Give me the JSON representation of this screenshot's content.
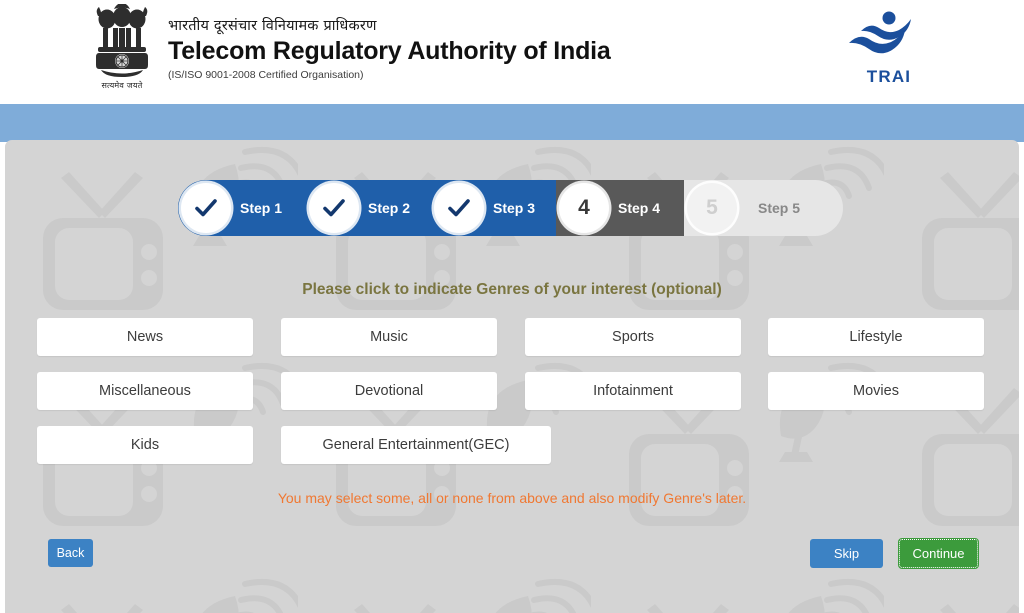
{
  "header": {
    "emblem_name": "ashoka-lion-capital-emblem",
    "emblem_motto": "सत्यमेव जयते",
    "title_hindi": "भारतीय दूरसंचार विनियामक प्राधिकरण",
    "title_main": "Telecom Regulatory Authority of India",
    "title_sub": "(IS/ISO 9001-2008 Certified Organisation)",
    "logo_text": "TRAI",
    "logo_name": "trai-logo",
    "colors": {
      "band": "#7facd9",
      "logo_blue": "#1b4f9c",
      "panel_gray": "#d4d4d4"
    }
  },
  "stepper": {
    "steps": [
      {
        "label": "Step 1",
        "marker": "check",
        "state": "completed"
      },
      {
        "label": "Step 2",
        "marker": "check",
        "state": "completed"
      },
      {
        "label": "Step 3",
        "marker": "check",
        "state": "completed"
      },
      {
        "label": "Step 4",
        "marker": "4",
        "state": "current"
      },
      {
        "label": "Step 5",
        "marker": "5",
        "state": "upcoming"
      }
    ],
    "colors": {
      "completed": "#1f5faa",
      "current": "#595959",
      "upcoming": "#e6e6e6"
    }
  },
  "main": {
    "instruction": "Please click to indicate Genres of your interest",
    "instruction_optional": "(optional)",
    "instruction_color": "#7a7540",
    "note": "You may select some, all or none from above and also modify Genre's later.",
    "note_color": "#f07832",
    "genres": [
      [
        "News",
        "Music",
        "Sports",
        "Lifestyle"
      ],
      [
        "Miscellaneous",
        "Devotional",
        "Infotainment",
        "Movies"
      ],
      [
        "Kids",
        "General Entertainment(GEC)"
      ]
    ]
  },
  "footer": {
    "back_label": "Back",
    "skip_label": "Skip",
    "continue_label": "Continue",
    "back_color": "#3c82c4",
    "skip_color": "#3c82c4",
    "continue_color": "#3c9b3c"
  }
}
